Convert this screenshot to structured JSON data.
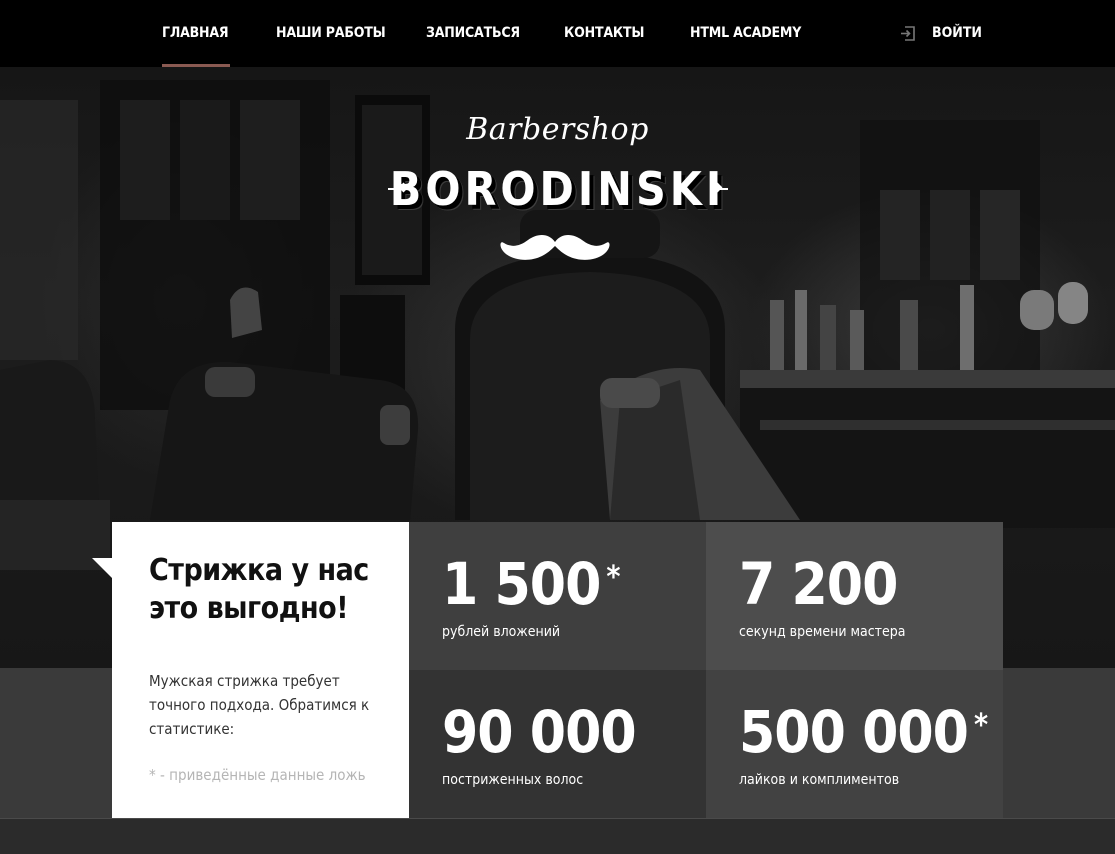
{
  "nav": {
    "items": [
      {
        "label": "ГЛАВНАЯ",
        "active": true
      },
      {
        "label": "НАШИ РАБОТЫ",
        "active": false
      },
      {
        "label": "ЗАПИСАТЬСЯ",
        "active": false
      },
      {
        "label": "КОНТАКТЫ",
        "active": false
      },
      {
        "label": "HTML ACADEMY",
        "active": false
      }
    ],
    "login": {
      "label": "ВОЙТИ",
      "icon": "login-icon"
    }
  },
  "logo": {
    "script": "Barbershop",
    "main": "BORODINSKI",
    "icon": "mustache-icon"
  },
  "promo": {
    "title": "Стрижка у нас это выгодно!",
    "text": "Мужская стрижка требует точного подхода. Обратимся к статистике:",
    "note": "* - приведённые данные ложь"
  },
  "stats": [
    {
      "value": "1 500",
      "star": "*",
      "label": "рублей вложений"
    },
    {
      "value": "7 200",
      "star": "",
      "label": "секунд времени мастера"
    },
    {
      "value": "90 000",
      "star": "",
      "label": "постриженных волос"
    },
    {
      "value": "500 000",
      "star": "*",
      "label": "лайков и комплиментов"
    }
  ],
  "colors": {
    "header": "#000000",
    "accent": "#8a5a52",
    "tile_1": "#3f3f3f",
    "tile_2": "#4d4d4d",
    "tile_3": "#333333",
    "tile_4": "#424242",
    "band": "#3a3a3a"
  }
}
